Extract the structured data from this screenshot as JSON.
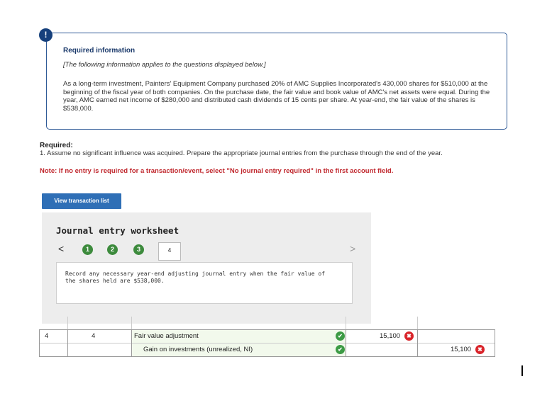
{
  "info": {
    "icon": "!",
    "title": "Required information",
    "subtitle": "[The following information applies to the questions displayed below.]",
    "body": "As a long-term investment, Painters' Equipment Company purchased 20% of AMC Supplies Incorporated's 430,000 shares for $510,000 at the beginning of the fiscal year of both companies. On the purchase date, the fair value and book value of AMC's net assets were equal. During the year, AMC earned net income of $280,000 and distributed cash dividends of 15 cents per share. At year-end, the fair value of the shares is $538,000."
  },
  "required": {
    "title": "Required:",
    "item": "1. Assume no significant influence was acquired. Prepare the appropriate journal entries from the purchase through the end of the year.",
    "note": "Note: If no entry is required for a transaction/event, select \"No journal entry required\" in the first account field."
  },
  "view_button": "View transaction list",
  "worksheet": {
    "title": "Journal entry worksheet",
    "prev": "<",
    "next": ">",
    "steps": [
      "1",
      "2",
      "3"
    ],
    "active_step": "4",
    "instruction": "Record any necessary year-end adjusting journal entry when the fair value of the shares held are $538,000."
  },
  "table": {
    "rows": [
      {
        "no": "4",
        "event": "4",
        "account": "Fair value adjustment",
        "debit": "15,100",
        "credit": ""
      },
      {
        "no": "",
        "event": "",
        "account": "Gain on investments (unrealized, NI)",
        "debit": "",
        "credit": "15,100"
      }
    ],
    "check_symbol": "✔",
    "x_symbol": "✖"
  },
  "colors": {
    "accent": "#2f6fb6",
    "note_red": "#c0272d",
    "check_green": "#3d9b45",
    "error_red": "#d9242a"
  }
}
